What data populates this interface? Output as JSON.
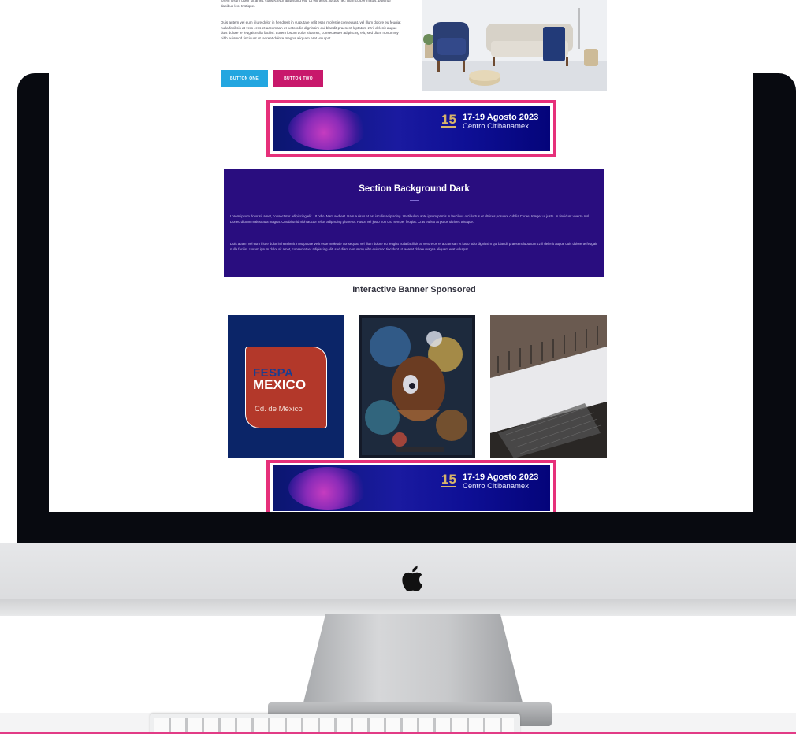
{
  "page": {
    "top_paragraph_1": "lorem ipsum dolor sit amet, consectetur adipiscing elit. Ut elit tellus, luctus nec ullamcorper mattis, pulvinar dapibus leo. tristique.",
    "top_paragraph_2": "Duis autem vel eum iriure dolor in hendrerit in vulputate velit esse molestie consequat, vel illum dolore eu feugiat nulla facilisis at vero eros et accumsan et iusto odio dignissim qui blandit praesent luptatum zzril delenit augue duis dolore te feugait nulla facilisi. Lorem ipsum dolor sit amet, consectetuer adipiscing elit, sed diam nonummy nibh euismod tincidunt ut laoreet dolore magna aliquam erat volutpat.",
    "button_one": "BUTTON ONE",
    "button_two": "BUTTON TWO"
  },
  "banner": {
    "number": "15",
    "dates": "17-19 Agosto 2023",
    "venue": "Centro Citibanamex"
  },
  "dark_section": {
    "title": "Section Background Dark",
    "paragraph_1": "Lorem ipsum dolor sit amet, consectetur adipiscing elit. Ut odio. Nam sed est. Nam a risus et est iaculis adipiscing. Vestibulum ante ipsum primis in faucibus orci luctus et ultrices posuere cubilia Curae; Integer ut justo. In tincidunt viverra nisl. Donec dictum malesuada magna. Curabitur id nibh auctor tellus adipiscing pharetra. Fusce vel justo non orci semper feugiat. Cras eu leo at purus ultrices tristique.",
    "paragraph_2": "Duis autem vel eum iriure dolor in hendrerit in vulputate velit esse molestie consequat, vel illum dolore eu feugiat nulla facilisis at vero eros et accumsan et iusto odio dignissim qui blandit praesent luptatum zzril delenit augue duis dolore te feugait nulla facilisi. Lorem ipsum dolor sit amet, consectetuer adipiscing elit, sed diam nonummy nibh euismod tincidunt ut laoreet dolore magna aliquam erat volutpat."
  },
  "sponsored": {
    "title": "Interactive Banner Sponsored",
    "fespa_line1": "FESPA",
    "fespa_line2": "MEXICO",
    "fespa_city": "Cd. de México"
  },
  "icons": {
    "monitor_logo": "apple-icon"
  },
  "colors": {
    "banner_border": "#e6307a",
    "dark_section_bg": "#290d7f",
    "button_one": "#23a6e0",
    "button_two": "#c8186b",
    "banner_gold": "#d8b56a"
  }
}
